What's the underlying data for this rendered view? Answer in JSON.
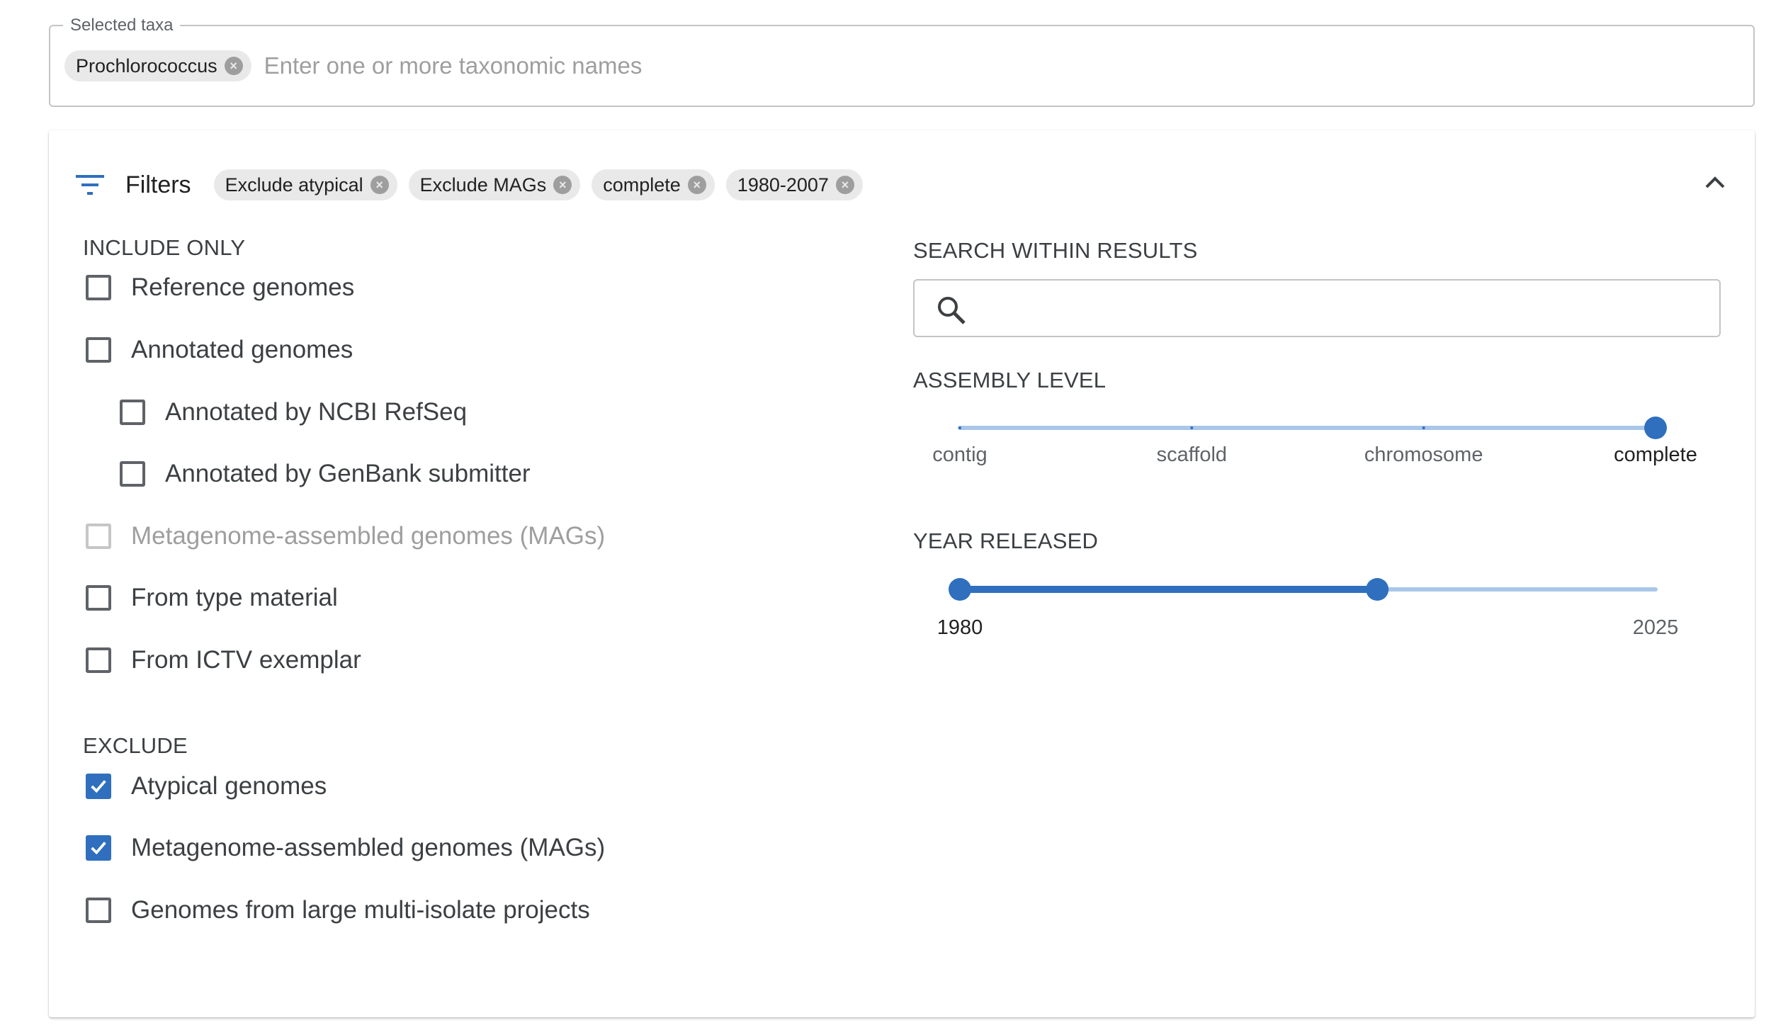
{
  "taxa": {
    "legend": "Selected taxa",
    "chips": [
      {
        "label": "Prochlorococcus"
      }
    ],
    "placeholder": "Enter one or more taxonomic names"
  },
  "filters": {
    "title": "Filters",
    "icon": "filter-list-icon",
    "collapse_icon": "chevron-up-icon",
    "active_chips": [
      {
        "label": "Exclude atypical"
      },
      {
        "label": "Exclude MAGs"
      },
      {
        "label": "complete"
      },
      {
        "label": "1980-2007"
      }
    ],
    "include_only": {
      "title": "INCLUDE ONLY",
      "options": [
        {
          "label": "Reference genomes",
          "checked": false,
          "disabled": false,
          "indent": false
        },
        {
          "label": "Annotated genomes",
          "checked": false,
          "disabled": false,
          "indent": false
        },
        {
          "label": "Annotated by NCBI RefSeq",
          "checked": false,
          "disabled": false,
          "indent": true
        },
        {
          "label": "Annotated by GenBank submitter",
          "checked": false,
          "disabled": false,
          "indent": true
        },
        {
          "label": "Metagenome-assembled genomes (MAGs)",
          "checked": false,
          "disabled": true,
          "indent": false
        },
        {
          "label": "From type material",
          "checked": false,
          "disabled": false,
          "indent": false
        },
        {
          "label": "From ICTV exemplar",
          "checked": false,
          "disabled": false,
          "indent": false
        }
      ]
    },
    "exclude": {
      "title": "EXCLUDE",
      "options": [
        {
          "label": "Atypical genomes",
          "checked": true,
          "disabled": false
        },
        {
          "label": "Metagenome-assembled genomes (MAGs)",
          "checked": true,
          "disabled": false
        },
        {
          "label": "Genomes from large multi-isolate projects",
          "checked": false,
          "disabled": false
        }
      ]
    },
    "search_within": {
      "title": "SEARCH WITHIN RESULTS",
      "value": "",
      "icon": "search-icon"
    },
    "assembly_level": {
      "title": "ASSEMBLY LEVEL",
      "marks": [
        "contig",
        "scaffold",
        "chromosome",
        "complete"
      ],
      "selected_index": 3
    },
    "year_released": {
      "title": "YEAR RELEASED",
      "min_label": "1980",
      "max_label": "2025",
      "min": 1980,
      "max": 2025,
      "range": [
        1980,
        2007
      ]
    }
  },
  "colors": {
    "accent": "#2f6fbe",
    "track_inactive": "#a9c7e8",
    "chip_bg": "#e9e9e9"
  }
}
